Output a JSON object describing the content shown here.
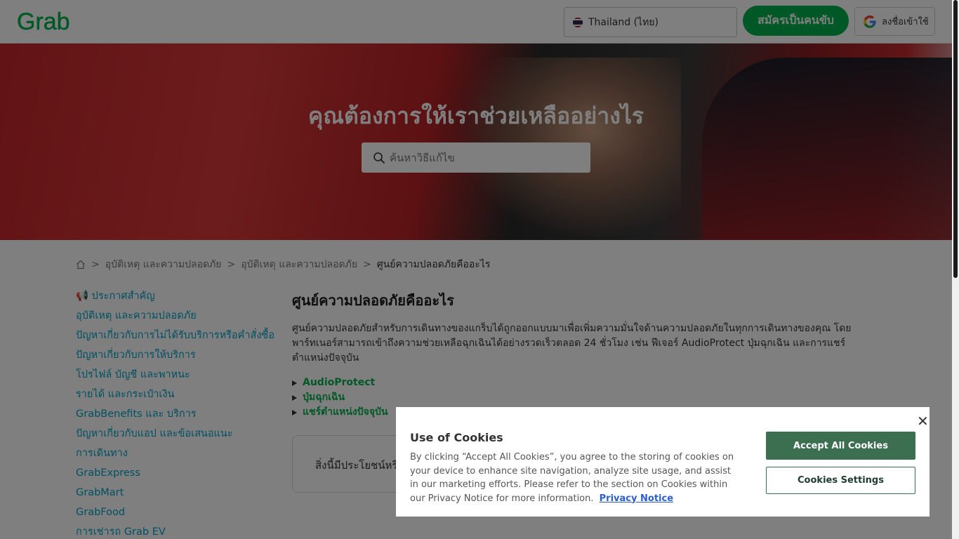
{
  "header": {
    "logo_text": "Grab",
    "language": "Thailand (ไทย)",
    "driver_button": "สมัครเป็นคนขับ",
    "signin_button": "ลงชื่อเข้าใช้"
  },
  "hero": {
    "title": "คุณต้องการให้เราช่วยเหลืออย่างไร",
    "search_placeholder": "ค้นหาวิธีแก้ไข"
  },
  "breadcrumb": {
    "items": [
      "อุบัติเหตุ และความปลอดภัย",
      "อุบัติเหตุ และความปลอดภัย"
    ],
    "current": "ศูนย์ความปลอดภัยคืออะไร",
    "separator": ">"
  },
  "sidebar": {
    "items": [
      "📢 ประกาศสำคัญ",
      "อุบัติเหตุ และความปลอดภัย",
      "ปัญหาเกี่ยวกับการไม่ได้รับบริการหรือคำสั่งซื้อ",
      "ปัญหาเกี่ยวกับการให้บริการ",
      "โปรไฟล์ บัญชี และพาหนะ",
      "รายได้ และกระเป๋าเงิน",
      "GrabBenefits และ บริการ",
      "ปัญหาเกี่ยวกับแอป และข้อเสนอแนะ",
      "การเดินทาง",
      "GrabExpress",
      "GrabMart",
      "GrabFood",
      "การเช่ารถ Grab EV"
    ]
  },
  "article": {
    "title": "ศูนย์ความปลอดภัยคืออะไร",
    "body": "ศูนย์ความปลอดภัยสำหรับการเดินทางของแกร็บได้ถูกออกแบบมาเพื่อเพิ่มความมั่นใจด้านความปลอดภัยในทุกการเดินทางของคุณ โดยพาร์ทเนอร์สามารถเข้าถึงความช่วยเหลือฉุกเฉินได้อย่างรวดเร็วตลอด 24 ชั่วโมง เช่น ฟีเจอร์ AudioProtect ปุ่มฉุกเฉิน และการแชร์ตำแหน่งปัจจุบัน",
    "faq": [
      "AudioProtect",
      "ปุ่มฉุกเฉิน",
      "แชร์ตำแหน่งปัจจุบัน"
    ],
    "helpful_text": "สิ่งนี้มีประโยชน์หรือ"
  },
  "cookie": {
    "title": "Use of Cookies",
    "body": "By clicking “Accept All Cookies”, you agree to the storing of cookies on your device to enhance site navigation, analyze site usage, and assist in our marketing efforts. Please refer to the section on Cookies within our Privacy Notice for more information.",
    "link": "Privacy Notice",
    "accept_button": "Accept All Cookies",
    "settings_button": "Cookies Settings",
    "close": "✕"
  },
  "colors": {
    "brand_green": "#00b14f",
    "link_blue": "#00a0c6",
    "cookie_green": "#3c6e50"
  }
}
